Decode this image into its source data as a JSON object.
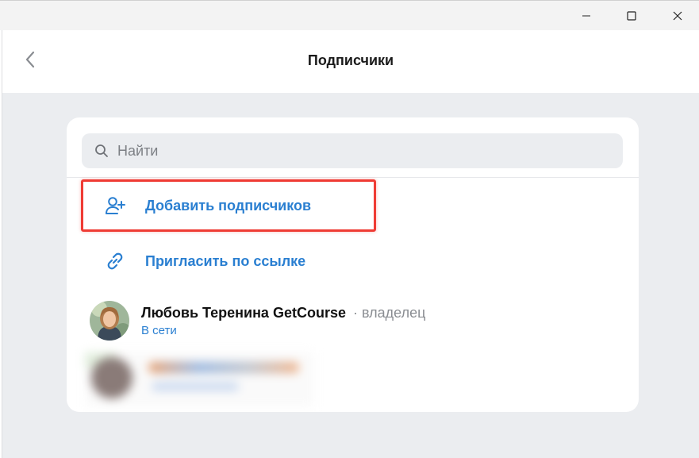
{
  "window": {
    "minimize_icon": "minimize-icon",
    "maximize_icon": "maximize-icon",
    "close_icon": "close-icon"
  },
  "header": {
    "back_icon": "chevron-left-icon",
    "title": "Подписчики"
  },
  "search": {
    "icon": "search-icon",
    "placeholder": "Найти",
    "value": ""
  },
  "actions": {
    "add": {
      "icon": "add-user-icon",
      "label": "Добавить подписчиков"
    },
    "invite": {
      "icon": "link-icon",
      "label": "Пригласить по ссылке"
    }
  },
  "members": [
    {
      "name": "Любовь Теренина GetCourse",
      "separator": "·",
      "role": "владелец",
      "status": "В сети"
    }
  ],
  "colors": {
    "accent": "#2a7fd1",
    "highlight": "#ef3b34",
    "background": "#ebedf0"
  }
}
